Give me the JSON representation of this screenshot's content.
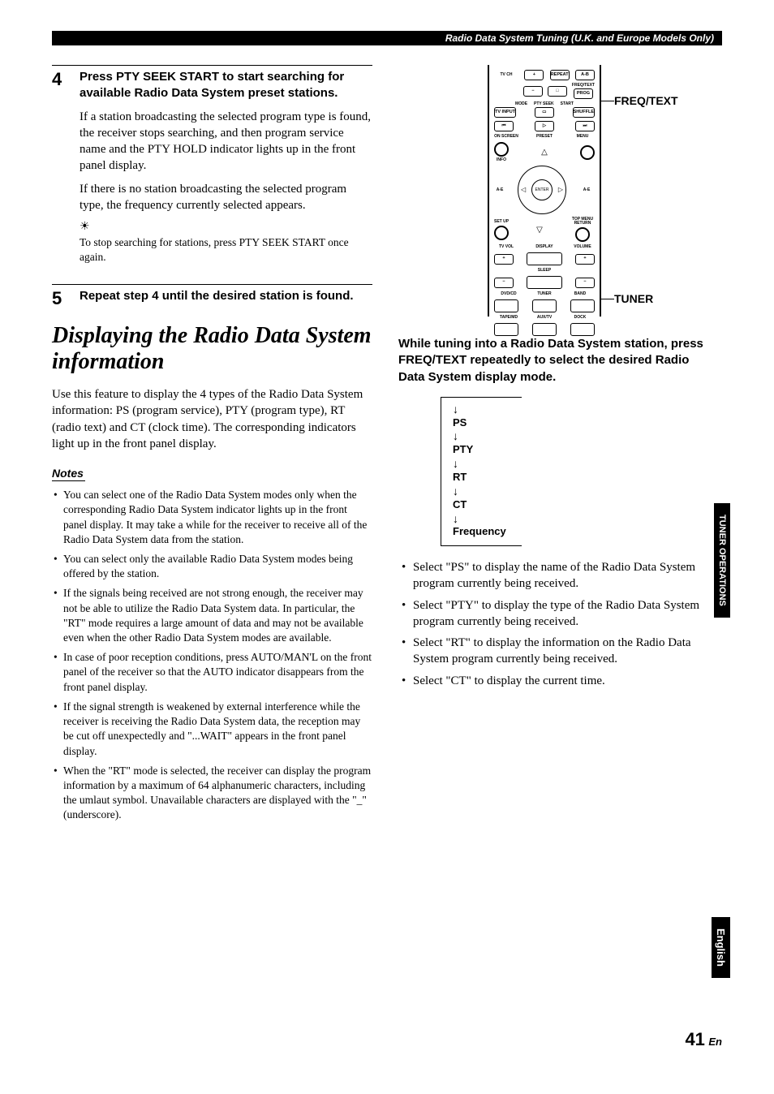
{
  "header": "Radio Data System Tuning (U.K. and Europe Models Only)",
  "left": {
    "step4": {
      "num": "4",
      "title": "Press PTY SEEK START to start searching for available Radio Data System preset stations.",
      "p1": "If a station broadcasting the selected program type is found, the receiver stops searching, and then program service name and the PTY HOLD indicator lights up in the front panel display.",
      "p2": "If there is no station broadcasting the selected program type, the frequency currently selected appears.",
      "tip": "To stop searching for stations, press PTY SEEK START once again."
    },
    "step5": {
      "num": "5",
      "title": "Repeat step 4 until the desired station is found."
    },
    "section": "Displaying the Radio Data System information",
    "sectionBody": "Use this feature to display the 4 types of the Radio Data System information: PS (program service), PTY (program type), RT (radio text) and CT (clock time). The corresponding indicators light up in the front panel display.",
    "notesLabel": "Notes",
    "notes": [
      "You can select one of the Radio Data System modes only when the corresponding Radio Data System indicator lights up in the front panel display. It may take a while for the receiver to receive all of the Radio Data System data from the station.",
      "You can select only the available Radio Data System modes being offered by the station.",
      "If the signals being received are not strong enough, the receiver may not be able to utilize the Radio Data System data. In particular, the \"RT\" mode requires a large amount of data and may not be available even when the other Radio Data System modes are available.",
      "In case of poor reception conditions, press AUTO/MAN'L on the front panel of the receiver so that the AUTO indicator disappears from the front panel display.",
      "If the signal strength is weakened by external interference while the receiver is receiving the Radio Data System data, the reception may be cut off unexpectedly and \"...WAIT\" appears in the front panel display.",
      "When the \"RT\" mode is selected, the receiver can display the program information by a maximum of 64 alphanumeric characters, including the umlaut symbol. Unavailable characters are displayed with the \"_\" (underscore)."
    ]
  },
  "right": {
    "annot1": "FREQ/TEXT",
    "annot2": "TUNER",
    "remote": {
      "tvch": "TV CH",
      "repeat": "REPEAT",
      "ab": "A-B",
      "freqtext": "FREQ/TEXT",
      "prog": "PROG",
      "ptyseek": "PTY SEEK",
      "mode": "MODE",
      "start": "START",
      "tvinput": "TV INPUT",
      "shuffle": "SHUFFLE",
      "onscreen": "ON SCREEN",
      "preset": "PRESET",
      "menu": "MENU",
      "info": "INFO",
      "ae_l": "A-E",
      "enter": "ENTER",
      "ae_r": "A-E",
      "setup": "SET UP",
      "topmenu": "TOP MENU RETURN",
      "tvvol": "TV VOL",
      "display": "DISPLAY",
      "volume": "VOLUME",
      "sleep": "SLEEP",
      "dvdcd": "DVD/CD",
      "tuner": "TUNER",
      "band": "BAND",
      "tapemd": "TAPE/MD",
      "auxtv": "AUX/TV",
      "dock": "DOCK"
    },
    "instruction": "While tuning into a Radio Data System station, press FREQ/TEXT repeatedly to select the desired Radio Data System display mode.",
    "flow": [
      "PS",
      "PTY",
      "RT",
      "CT",
      "Frequency"
    ],
    "bullets": [
      "Select \"PS\" to display the name of the Radio Data System program currently being received.",
      "Select \"PTY\" to display the type of the Radio Data System program currently being received.",
      "Select \"RT\" to display the information on the Radio Data System program currently being received.",
      "Select \"CT\" to display the current time."
    ]
  },
  "tabs": {
    "ops": "TUNER\nOPERATIONS",
    "eng": "English"
  },
  "page": {
    "num": "41",
    "suffix": "En"
  }
}
